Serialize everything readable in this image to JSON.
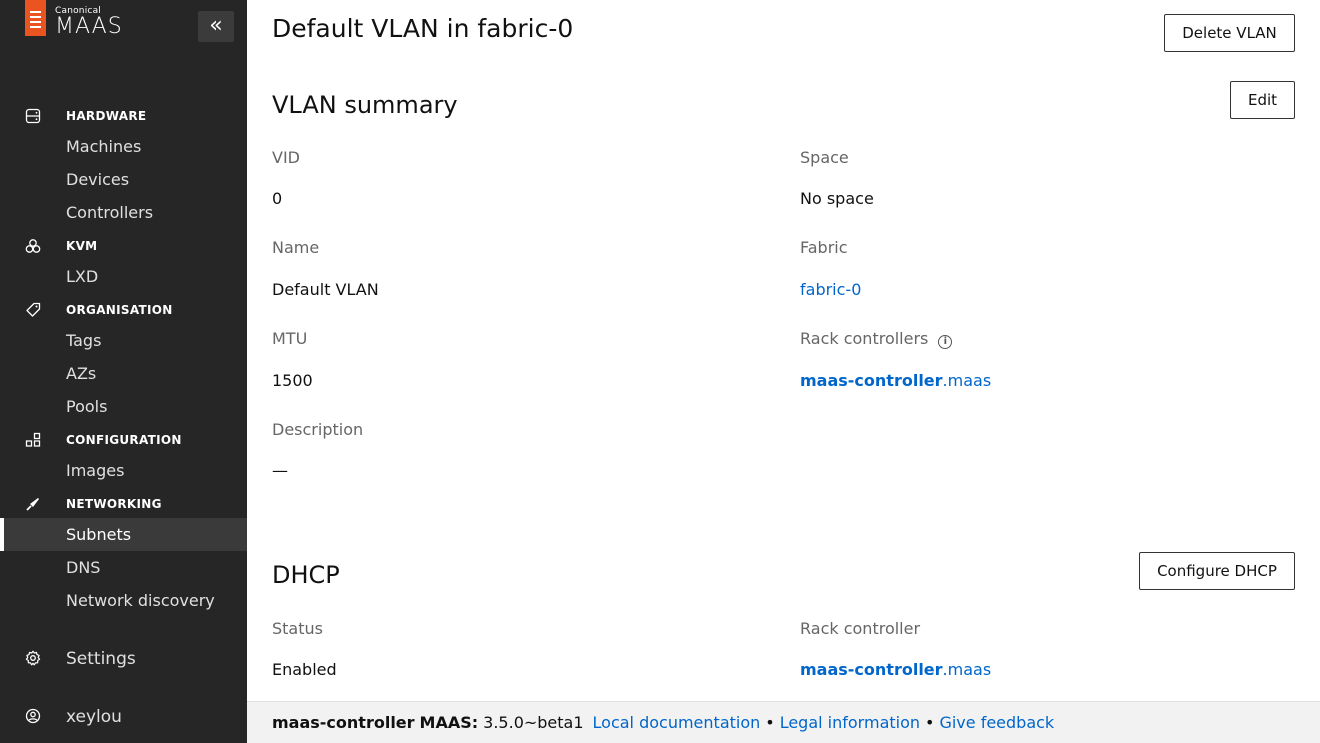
{
  "sidebar": {
    "brand_small": "Canonical",
    "brand_big": "MAAS",
    "collapse_icon": "«",
    "groups": [
      {
        "label": "HARDWARE",
        "icon": "hardware-icon",
        "items": [
          "Machines",
          "Devices",
          "Controllers"
        ]
      },
      {
        "label": "KVM",
        "icon": "kvm-icon",
        "items": [
          "LXD"
        ]
      },
      {
        "label": "ORGANISATION",
        "icon": "tag-icon",
        "items": [
          "Tags",
          "AZs",
          "Pools"
        ]
      },
      {
        "label": "CONFIGURATION",
        "icon": "configuration-icon",
        "items": [
          "Images"
        ]
      },
      {
        "label": "NETWORKING",
        "icon": "networking-icon",
        "items": [
          "Subnets",
          "DNS",
          "Network discovery"
        ]
      }
    ],
    "active_item": "Subnets",
    "settings_label": "Settings",
    "user_label": "xeylou"
  },
  "page": {
    "title": "Default VLAN in fabric-0",
    "delete_button": "Delete VLAN"
  },
  "summary": {
    "heading": "VLAN summary",
    "edit_button": "Edit",
    "vid_label": "VID",
    "vid_value": "0",
    "space_label": "Space",
    "space_value": "No space",
    "name_label": "Name",
    "name_value": "Default VLAN",
    "fabric_label": "Fabric",
    "fabric_value": "fabric-0",
    "mtu_label": "MTU",
    "mtu_value": "1500",
    "rack_label": "Rack controllers",
    "rack_host": "maas-controller",
    "rack_domain": ".maas",
    "description_label": "Description",
    "description_value": "—"
  },
  "dhcp": {
    "heading": "DHCP",
    "configure_button": "Configure DHCP",
    "status_label": "Status",
    "status_value": "Enabled",
    "rack_label": "Rack controller",
    "rack_host": "maas-controller",
    "rack_domain": ".maas"
  },
  "footer": {
    "host": "maas-controller",
    "product": "MAAS:",
    "version": "3.5.0~beta1",
    "local_docs": "Local documentation",
    "legal": "Legal information",
    "feedback": "Give feedback",
    "separator": "•"
  }
}
